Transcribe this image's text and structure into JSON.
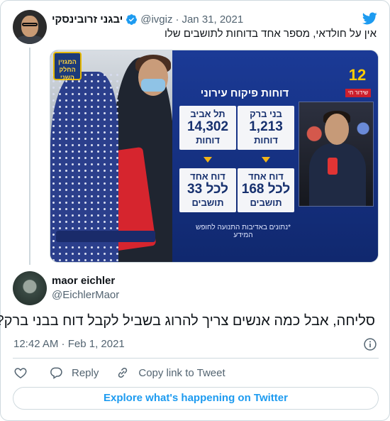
{
  "parent_tweet": {
    "author_name": "יבגני זרובינסקי",
    "handle": "@ivgiz",
    "separator": "·",
    "date": "Jan 31, 2021",
    "text": "אין על חולדאי, מספר אחד בדוחות לתושבים שלו",
    "media": {
      "corner_logo": "המגזין החלק השני",
      "panel_title": "דוחות פיקוח עירוני",
      "boxes": {
        "top_left": {
          "line1": "תל אביב",
          "line2": "14,302",
          "line3": "דוחות"
        },
        "top_right": {
          "line1": "בני ברק",
          "line2": "1,213",
          "line3": "דוחות"
        },
        "bottom_left": {
          "line1": "דוח אחד",
          "line2": "לכל 33",
          "line3": "תושבים"
        },
        "bottom_right": {
          "line1": "דוח אחד",
          "line2": "לכל 168",
          "line3": "תושבים"
        }
      },
      "note": "*נתונים באדיבות התנועה לחופש המידע",
      "channel_number": "12",
      "channel_tag": "שידור חי",
      "accent_color": "#f2b417"
    }
  },
  "reply": {
    "author_name": "maor eichler",
    "handle": "@EichlerMaor",
    "text": "סליחה, אבל כמה אנשים צריך להרוג בשביל לקבל דוח בבני ברק?",
    "timestamp": "12:42 AM · Feb 1, 2021"
  },
  "actions": {
    "like_icon": "heart-icon",
    "reply_label": "Reply",
    "copy_link_label": "Copy link to Tweet"
  },
  "explore_button": "Explore what's happening on Twitter",
  "colors": {
    "brand": "#1d9bf0",
    "text": "#0f1419",
    "secondary": "#536471",
    "border": "#cfd9de"
  }
}
